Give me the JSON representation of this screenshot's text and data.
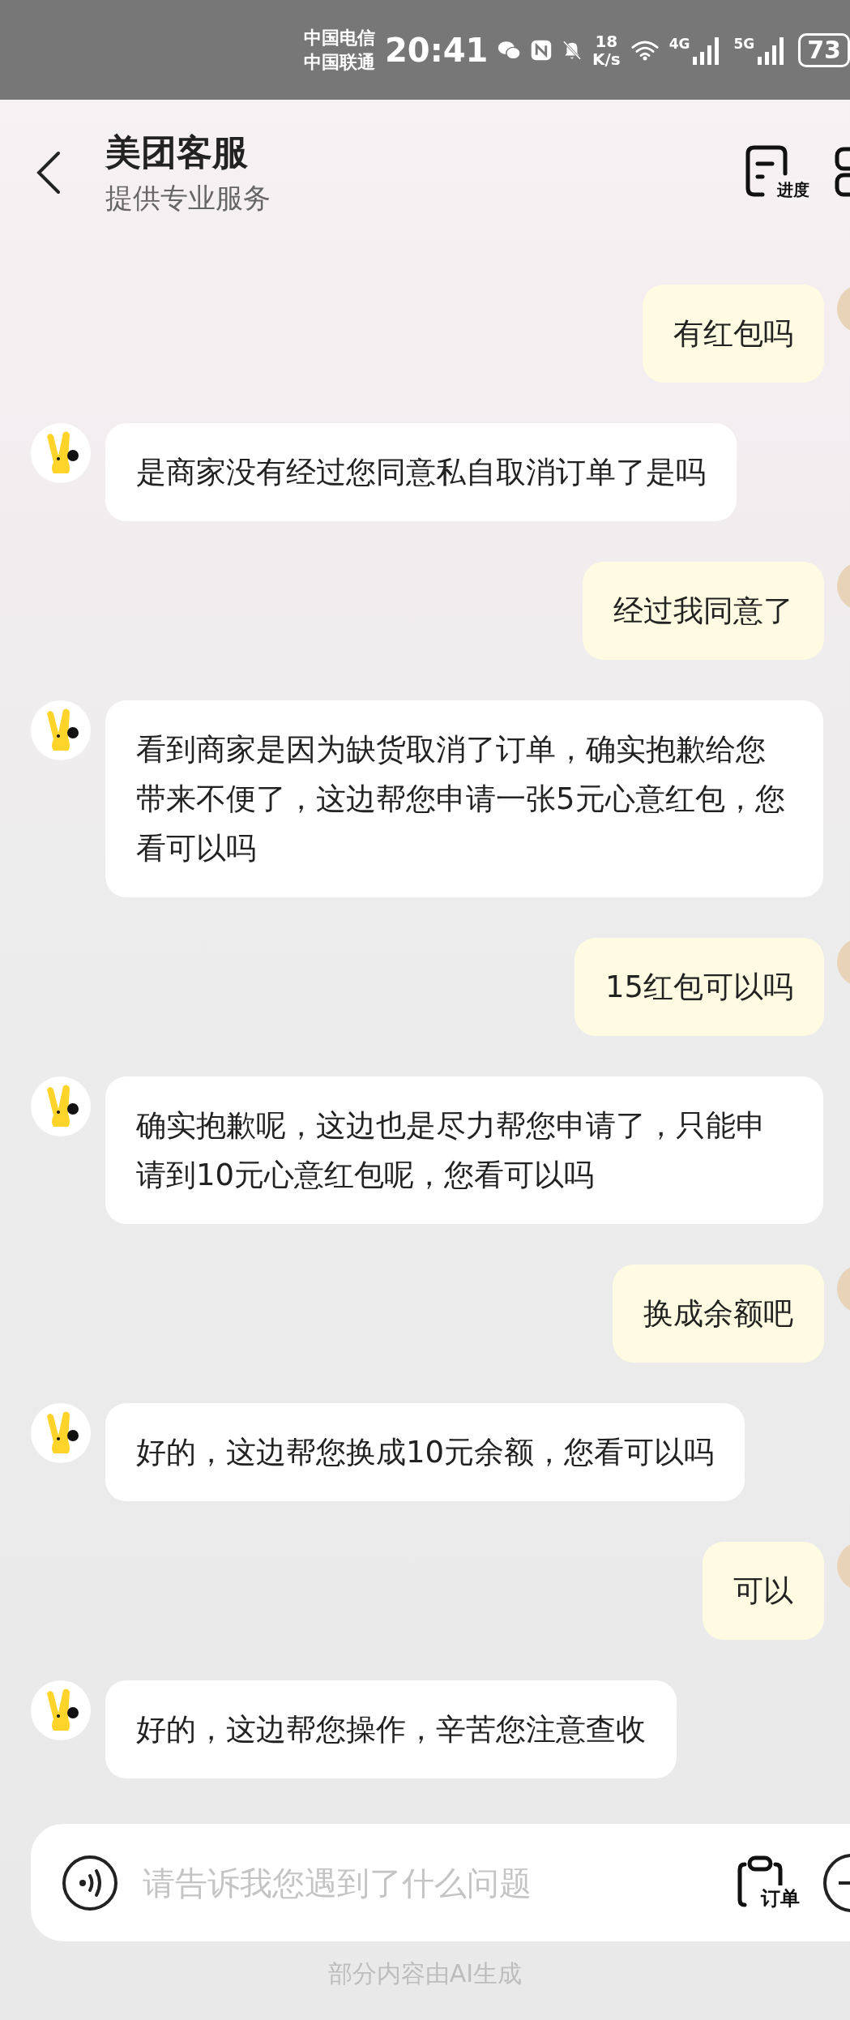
{
  "status_bar": {
    "carriers": [
      "中国电信",
      "中国联通"
    ],
    "time": "20:41",
    "speed_value": "18",
    "speed_unit": "K/s",
    "networks": [
      "4G",
      "5G"
    ],
    "battery": "73"
  },
  "header": {
    "title": "美团客服",
    "subtitle": "提供专业服务",
    "actions": [
      {
        "kind": "progress",
        "label": "进度"
      },
      {
        "kind": "more"
      }
    ]
  },
  "messages": [
    {
      "kind": "user",
      "text": "有红包吗"
    },
    {
      "kind": "agent",
      "text": "是商家没有经过您同意私自取消订单了是吗"
    },
    {
      "kind": "user",
      "text": "经过我同意了"
    },
    {
      "kind": "agent",
      "text": "看到商家是因为缺货取消了订单，确实抱歉给您带来不便了，这边帮您申请一张5元心意红包，您看可以吗"
    },
    {
      "kind": "user",
      "text": "15红包可以吗"
    },
    {
      "kind": "agent",
      "text": "确实抱歉呢，这边也是尽力帮您申请了，只能申请到10元心意红包呢，您看可以吗"
    },
    {
      "kind": "user",
      "text": "换成余额吧"
    },
    {
      "kind": "agent",
      "text": "好的，这边帮您换成10元余额，您看可以吗"
    },
    {
      "kind": "user",
      "text": "可以"
    },
    {
      "kind": "agent",
      "text": "好的，这边帮您操作，辛苦您注意查收"
    }
  ],
  "composer": {
    "placeholder": "请告诉我您遇到了什么问题",
    "order_label": "订单"
  },
  "footer": "部分内容由AI生成"
}
